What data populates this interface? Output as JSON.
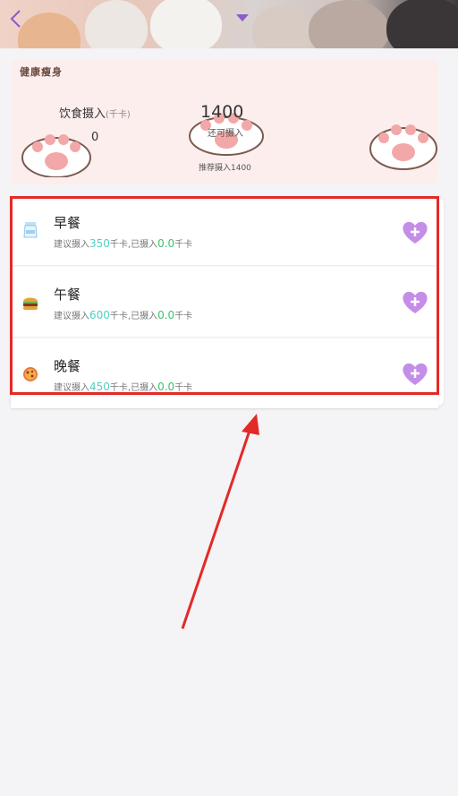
{
  "header": {
    "back_icon": "chevron-left-icon",
    "dropdown_icon": "triangle-down-icon"
  },
  "summary": {
    "title": "健康瘦身",
    "intake_label": "饮食摄入",
    "intake_unit": "(千卡)",
    "intake_value": "0",
    "remaining_value": "1400",
    "remaining_label": "还可摄入",
    "recommend_text": "推荐摄入1400"
  },
  "meals": [
    {
      "name": "早餐",
      "icon": "milk-icon",
      "prefix": "建议摄入",
      "suggested": "350",
      "mid": "千卡,已摄入",
      "eaten": "0.0",
      "suffix": "千卡"
    },
    {
      "name": "午餐",
      "icon": "burger-icon",
      "prefix": "建议摄入",
      "suggested": "600",
      "mid": "千卡,已摄入",
      "eaten": "0.0",
      "suffix": "千卡"
    },
    {
      "name": "晚餐",
      "icon": "pizza-icon",
      "prefix": "建议摄入",
      "suggested": "450",
      "mid": "千卡,已摄入",
      "eaten": "0.0",
      "suffix": "千卡"
    }
  ],
  "colors": {
    "highlight_frame": "#e22a27",
    "suggested_number": "#4fd0c0",
    "eaten_number": "#3ec06c",
    "add_button": "#c48ee8"
  }
}
